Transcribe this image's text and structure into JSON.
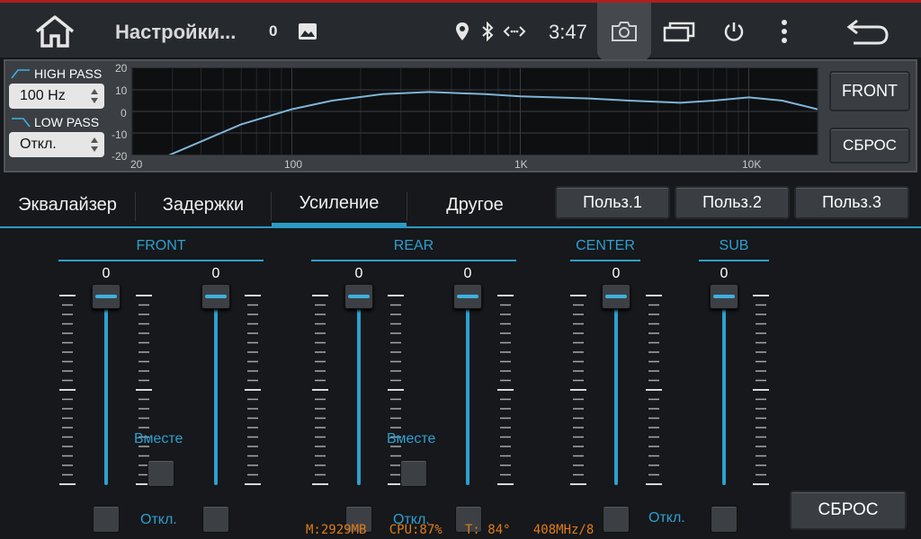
{
  "statusbar": {
    "title": "Настройки...",
    "notif_count": "0",
    "time": "3:47",
    "icons": [
      "home-icon",
      "image-icon",
      "location-icon",
      "bluetooth-icon",
      "link-icon",
      "camera-icon",
      "recents-icon",
      "power-icon",
      "more-icon",
      "back-icon"
    ]
  },
  "filters": {
    "high_pass_label": "HIGH PASS",
    "high_pass_value": "100 Hz",
    "low_pass_label": "LOW PASS",
    "low_pass_value": "Откл."
  },
  "graph": {
    "y_ticks": [
      "20",
      "10",
      "0",
      "-10",
      "-20"
    ],
    "x_ticks": [
      "20",
      "100",
      "1K",
      "10K"
    ],
    "curve_color": "#7fb5d6"
  },
  "right_buttons": {
    "channel": "FRONT",
    "reset": "СБРОС"
  },
  "tabs": {
    "items": [
      "Эквалайзер",
      "Задержки",
      "Усиление",
      "Другое"
    ],
    "active": "Усиление"
  },
  "presets": [
    "Польз.1",
    "Польз.2",
    "Польз.3"
  ],
  "groups": {
    "front": "FRONT",
    "rear": "REAR",
    "center": "CENTER",
    "sub": "SUB"
  },
  "sliders": {
    "front_left": "0",
    "front_right": "0",
    "rear_left": "0",
    "rear_right": "0",
    "center": "0",
    "sub": "0"
  },
  "labels": {
    "together_front": "Вместе",
    "together_rear": "Вместе",
    "off_front": "Откл.",
    "off_rear": "Откл.",
    "off_center": "Откл."
  },
  "reset_button": "СБРОС",
  "stats": "M:2929MB   CPU:87%   T: 84°   408MHz/8",
  "colors": {
    "accent": "#2f9fd0",
    "statusbar_top": "#b11f1f"
  }
}
